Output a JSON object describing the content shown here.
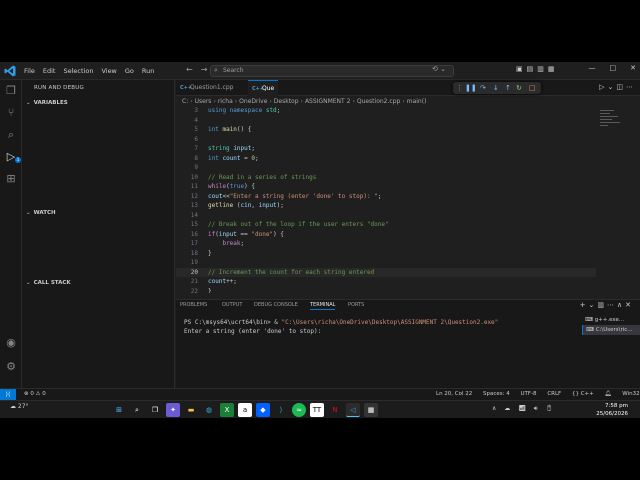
{
  "menu": [
    "File",
    "Edit",
    "Selection",
    "View",
    "Go",
    "Run"
  ],
  "search": {
    "label": "Search"
  },
  "sidebar": {
    "title": "RUN AND DEBUG",
    "sections": [
      "VARIABLES",
      "WATCH",
      "CALL STACK"
    ],
    "activity_badge": "1"
  },
  "tabs": [
    {
      "label": "Question1.cpp",
      "icon": "C++"
    },
    {
      "label": "Que",
      "icon": "C++"
    }
  ],
  "breadcrumb": [
    "C:",
    "Users",
    "richa",
    "OneDrive",
    "Desktop",
    "ASSIGNMENT 2",
    "Question2.cpp",
    "main()"
  ],
  "code": {
    "lines": [
      {
        "n": "3",
        "html": "<span class='kw'>using</span> <span class='kw'>namespace</span> <span class='ty'>std</span>;"
      },
      {
        "n": "4",
        "html": ""
      },
      {
        "n": "5",
        "html": "<span class='kw'>int</span> <span class='fn'>main</span>() {"
      },
      {
        "n": "6",
        "html": ""
      },
      {
        "n": "7",
        "html": "<span class='ty'>string</span> <span class='var'>input</span>;"
      },
      {
        "n": "8",
        "html": "<span class='kw'>int</span> <span class='var'>count</span> = <span class='num'>0</span>;"
      },
      {
        "n": "9",
        "html": ""
      },
      {
        "n": "10",
        "html": "<span class='cm'>// Read in a series of strings</span>"
      },
      {
        "n": "11",
        "html": "<span class='ctl'>while</span>(<span class='kw'>true</span>) {"
      },
      {
        "n": "12",
        "html": "<span class='var'>cout</span>&lt;&lt;<span class='str'>\"Enter a string (enter 'done' to stop): \"</span>;"
      },
      {
        "n": "13",
        "html": "<span class='fn'>getline</span> (<span class='var'>cin</span>, <span class='var'>input</span>);"
      },
      {
        "n": "14",
        "html": ""
      },
      {
        "n": "15",
        "html": "<span class='cm'>// Break out of the loop if the user enters \"done\"</span>"
      },
      {
        "n": "16",
        "html": "<span class='ctl'>if</span>(<span class='var'>input</span> == <span class='str'>\"done\"</span>) {"
      },
      {
        "n": "17",
        "html": "    <span class='ctl'>break</span>;"
      },
      {
        "n": "18",
        "html": "}"
      },
      {
        "n": "19",
        "html": ""
      },
      {
        "n": "20",
        "html": "<span class='cm'>// Increment the count for each string entered</span>",
        "current": true
      },
      {
        "n": "21",
        "html": "<span class='var'>count</span>++;"
      },
      {
        "n": "22",
        "html": "}"
      }
    ]
  },
  "panel": {
    "tabs": [
      "PROBLEMS",
      "OUTPUT",
      "DEBUG CONSOLE",
      "TERMINAL",
      "PORTS"
    ],
    "active_tab": "TERMINAL",
    "terminal": {
      "prompt": "PS C:\\msys64\\ucrt64\\bin> & ",
      "command": "\"C:\\Users\\richa\\OneDrive\\Desktop\\ASSIGNMENT 2\\Question2.exe\"",
      "output": "Enter a string (enter 'done' to stop):"
    },
    "terminal_list": [
      "g++.exe...",
      "C:\\Users\\ric..."
    ]
  },
  "status": {
    "problems": "⊗ 0  ⚠ 0",
    "position": "Ln 20, Col 22",
    "spaces": "Spaces: 4",
    "encoding": "UTF-8",
    "eol": "CRLF",
    "language": "{} C++",
    "platform": "Win32"
  },
  "taskbar": {
    "weather": "27°",
    "time": "7:58 pm",
    "date": "25/06/2026"
  },
  "colors": {
    "accent": "#0078d4",
    "editor_bg": "#1f1f1f",
    "sidebar_bg": "#181818"
  }
}
